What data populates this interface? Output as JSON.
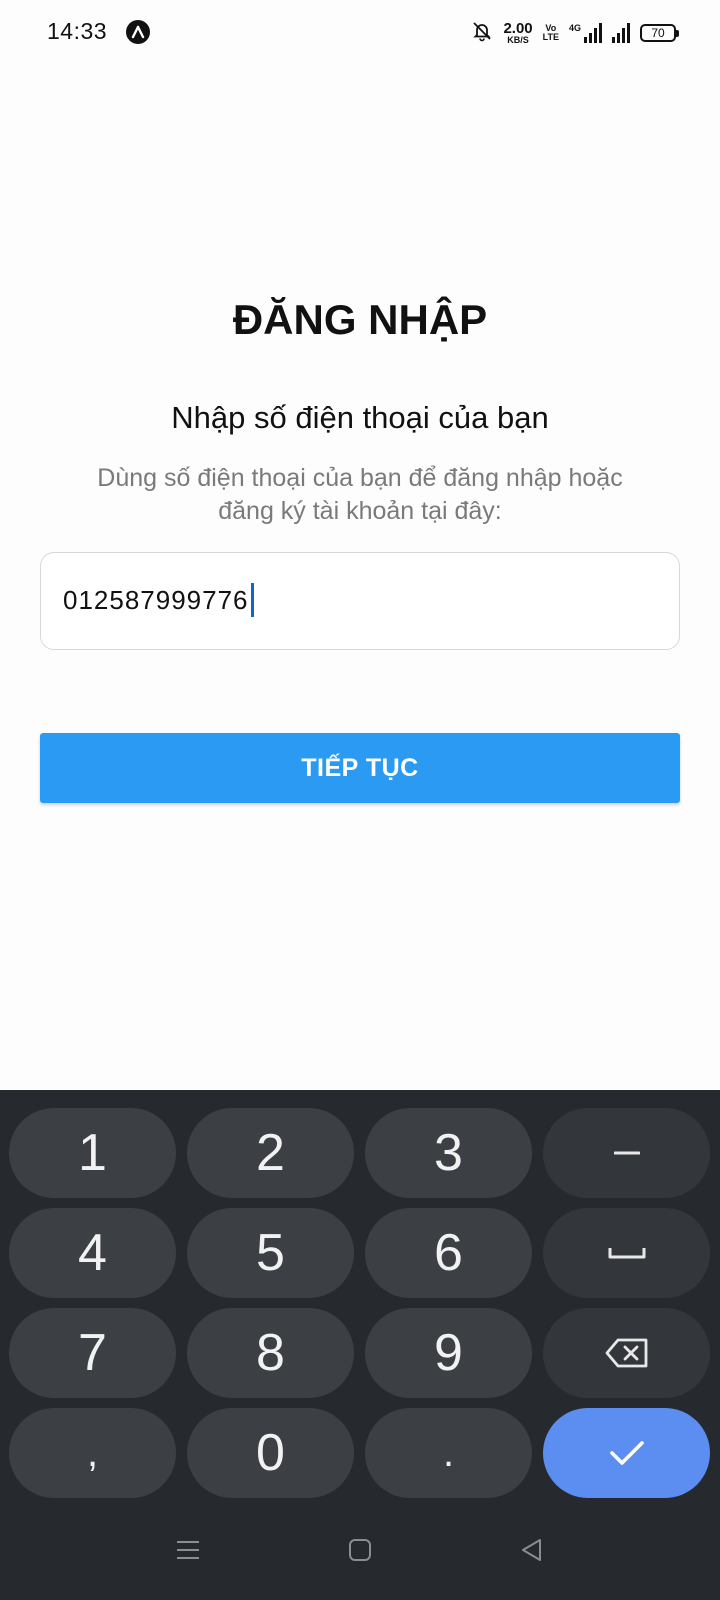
{
  "status_bar": {
    "time": "14:33",
    "app_icon": "triangle-a-icon",
    "net_speed_value": "2.00",
    "net_speed_unit": "KB/S",
    "volte_top": "Vo",
    "volte_bottom": "LTE",
    "network_type": "4G",
    "battery_level": "70"
  },
  "login": {
    "title": "ĐĂNG NHẬP",
    "subtitle": "Nhập số điện thoại của bạn",
    "helper_line1": "Dùng số điện thoại của bạn để đăng nhập hoặc",
    "helper_line2": "đăng ký tài khoản tại đây:",
    "phone_value": "012587999776",
    "continue_label": "TIẾP TỤC"
  },
  "keyboard": {
    "keys": [
      "1",
      "2",
      "3",
      "−",
      "4",
      "5",
      "6",
      "␣",
      "7",
      "8",
      "9",
      "⌫",
      ",",
      "0",
      ".",
      "✓"
    ],
    "k1": "1",
    "k2": "2",
    "k3": "3",
    "k4": "4",
    "k5": "5",
    "k6": "6",
    "k7": "7",
    "k8": "8",
    "k9": "9",
    "k0": "0",
    "comma": ",",
    "period": ".",
    "minus": "−"
  },
  "nav": {
    "icons": [
      "menu-icon",
      "home-icon",
      "back-icon"
    ]
  },
  "colors": {
    "accent": "#2a9af3",
    "keyboard_bg": "#262a2f",
    "key_bg": "#3c4045",
    "enter_key": "#5b8ef0"
  }
}
